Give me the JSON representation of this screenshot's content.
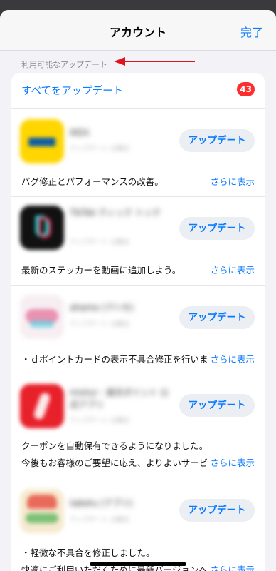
{
  "nav": {
    "title": "アカウント",
    "done_label": "完了"
  },
  "section": {
    "label": "利用可能なアップデート"
  },
  "update_all": {
    "label": "すべてをアップデート",
    "count": "43"
  },
  "apps": [
    {
      "name": "IKEA",
      "sub": "アップデート 公開日",
      "button": "アップデート",
      "notes": [
        "バグ修正とパフォーマンスの改善。"
      ],
      "more": "さらに表示",
      "icon_color": "#ffd600"
    },
    {
      "name": "TikTok ティック トック",
      "sub": "アップデート 公開日",
      "button": "アップデート",
      "notes": [
        "最新のステッカーを動画に追加しよう。"
      ],
      "more": "さらに表示",
      "icon_color": "#111111"
    },
    {
      "name": "ahamo (アハモ)",
      "sub": "アップデート 公開日",
      "button": "アップデート",
      "notes": [
        "・ｄポイントカードの表示不具合修正を行いました"
      ],
      "more": "さらに表示",
      "icon_color": "#f2d0d8"
    },
    {
      "name": "mixtur - 楽天ポイント 公式アプリ",
      "sub": "アップデート 公開日",
      "button": "アップデート",
      "notes": [
        "クーポンを自動保有できるようになりました。",
        "今後もお客様のご要望に応え、よりよいサービスを"
      ],
      "more": "さらに表示",
      "icon_color": "#e8202a"
    },
    {
      "name": "tabetu (アプリ)",
      "sub": "アップデート 公開日",
      "button": "アップデート",
      "notes": [
        "・軽微な不具合を修正しました。",
        "快適にご利用いただくために最新バージョンへ"
      ],
      "more": "さらに表示",
      "icon_color": "#f4e6c8"
    }
  ]
}
